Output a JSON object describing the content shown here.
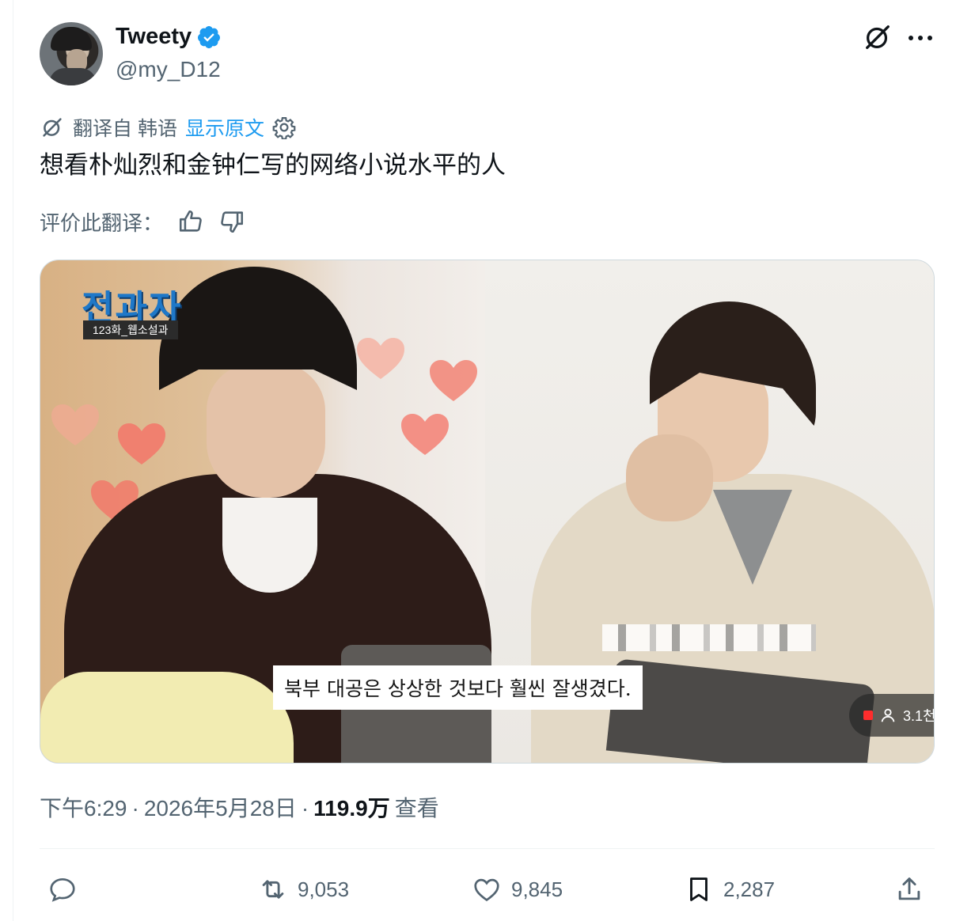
{
  "author": {
    "display_name": "Tweety",
    "handle": "@my_D12",
    "verified": true,
    "verified_color": "#1d9bf0"
  },
  "header_icons": [
    "grok-icon",
    "more-icon"
  ],
  "translation": {
    "source_label": "翻译自 韩语",
    "show_original": "显示原文",
    "link_color": "#1d9bf0"
  },
  "tweet": {
    "text": "想看朴灿烈和金钟仁写的网络小说水平的人"
  },
  "rate_translation": {
    "label": "评价此翻译："
  },
  "media": {
    "show_logo": "전과자",
    "episode_label": "123화_웹소설과",
    "subtitle": "북부 대공은 상상한 것보다 훨씬 잘생겼다.",
    "view_count_overlay": "3.1천"
  },
  "meta": {
    "time": "下午6:29",
    "date": "2026年5月28日",
    "views_count": "119.9万",
    "views_label": "查看"
  },
  "actions": {
    "reply_count": "",
    "retweet_count": "9,053",
    "like_count": "9,845",
    "bookmark_count": "2,287"
  }
}
